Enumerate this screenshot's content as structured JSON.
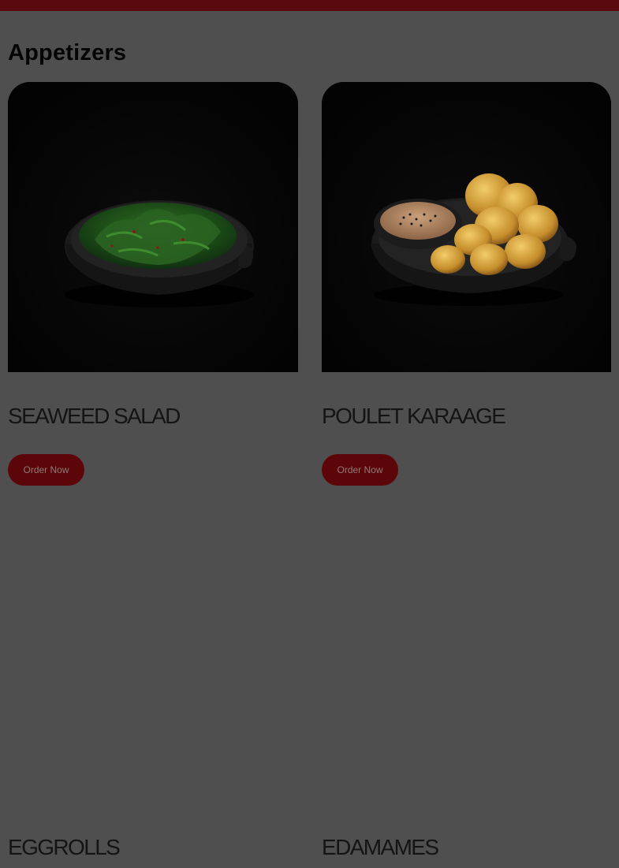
{
  "section": {
    "title": "Appetizers"
  },
  "colors": {
    "overlay_background": "#4f4f4f",
    "top_bar": "#5a0a0f",
    "button_background": "#5d0609",
    "button_text": "#8d7a7a"
  },
  "items": [
    {
      "name": "SEAWEED SALAD",
      "button_label": "Order Now",
      "image_icon": "seaweed-salad-photo"
    },
    {
      "name": "POULET KARAAGE",
      "button_label": "Order Now",
      "image_icon": "karaage-photo"
    },
    {
      "name": "EGGROLLS"
    },
    {
      "name": "EDAMAMES"
    }
  ]
}
